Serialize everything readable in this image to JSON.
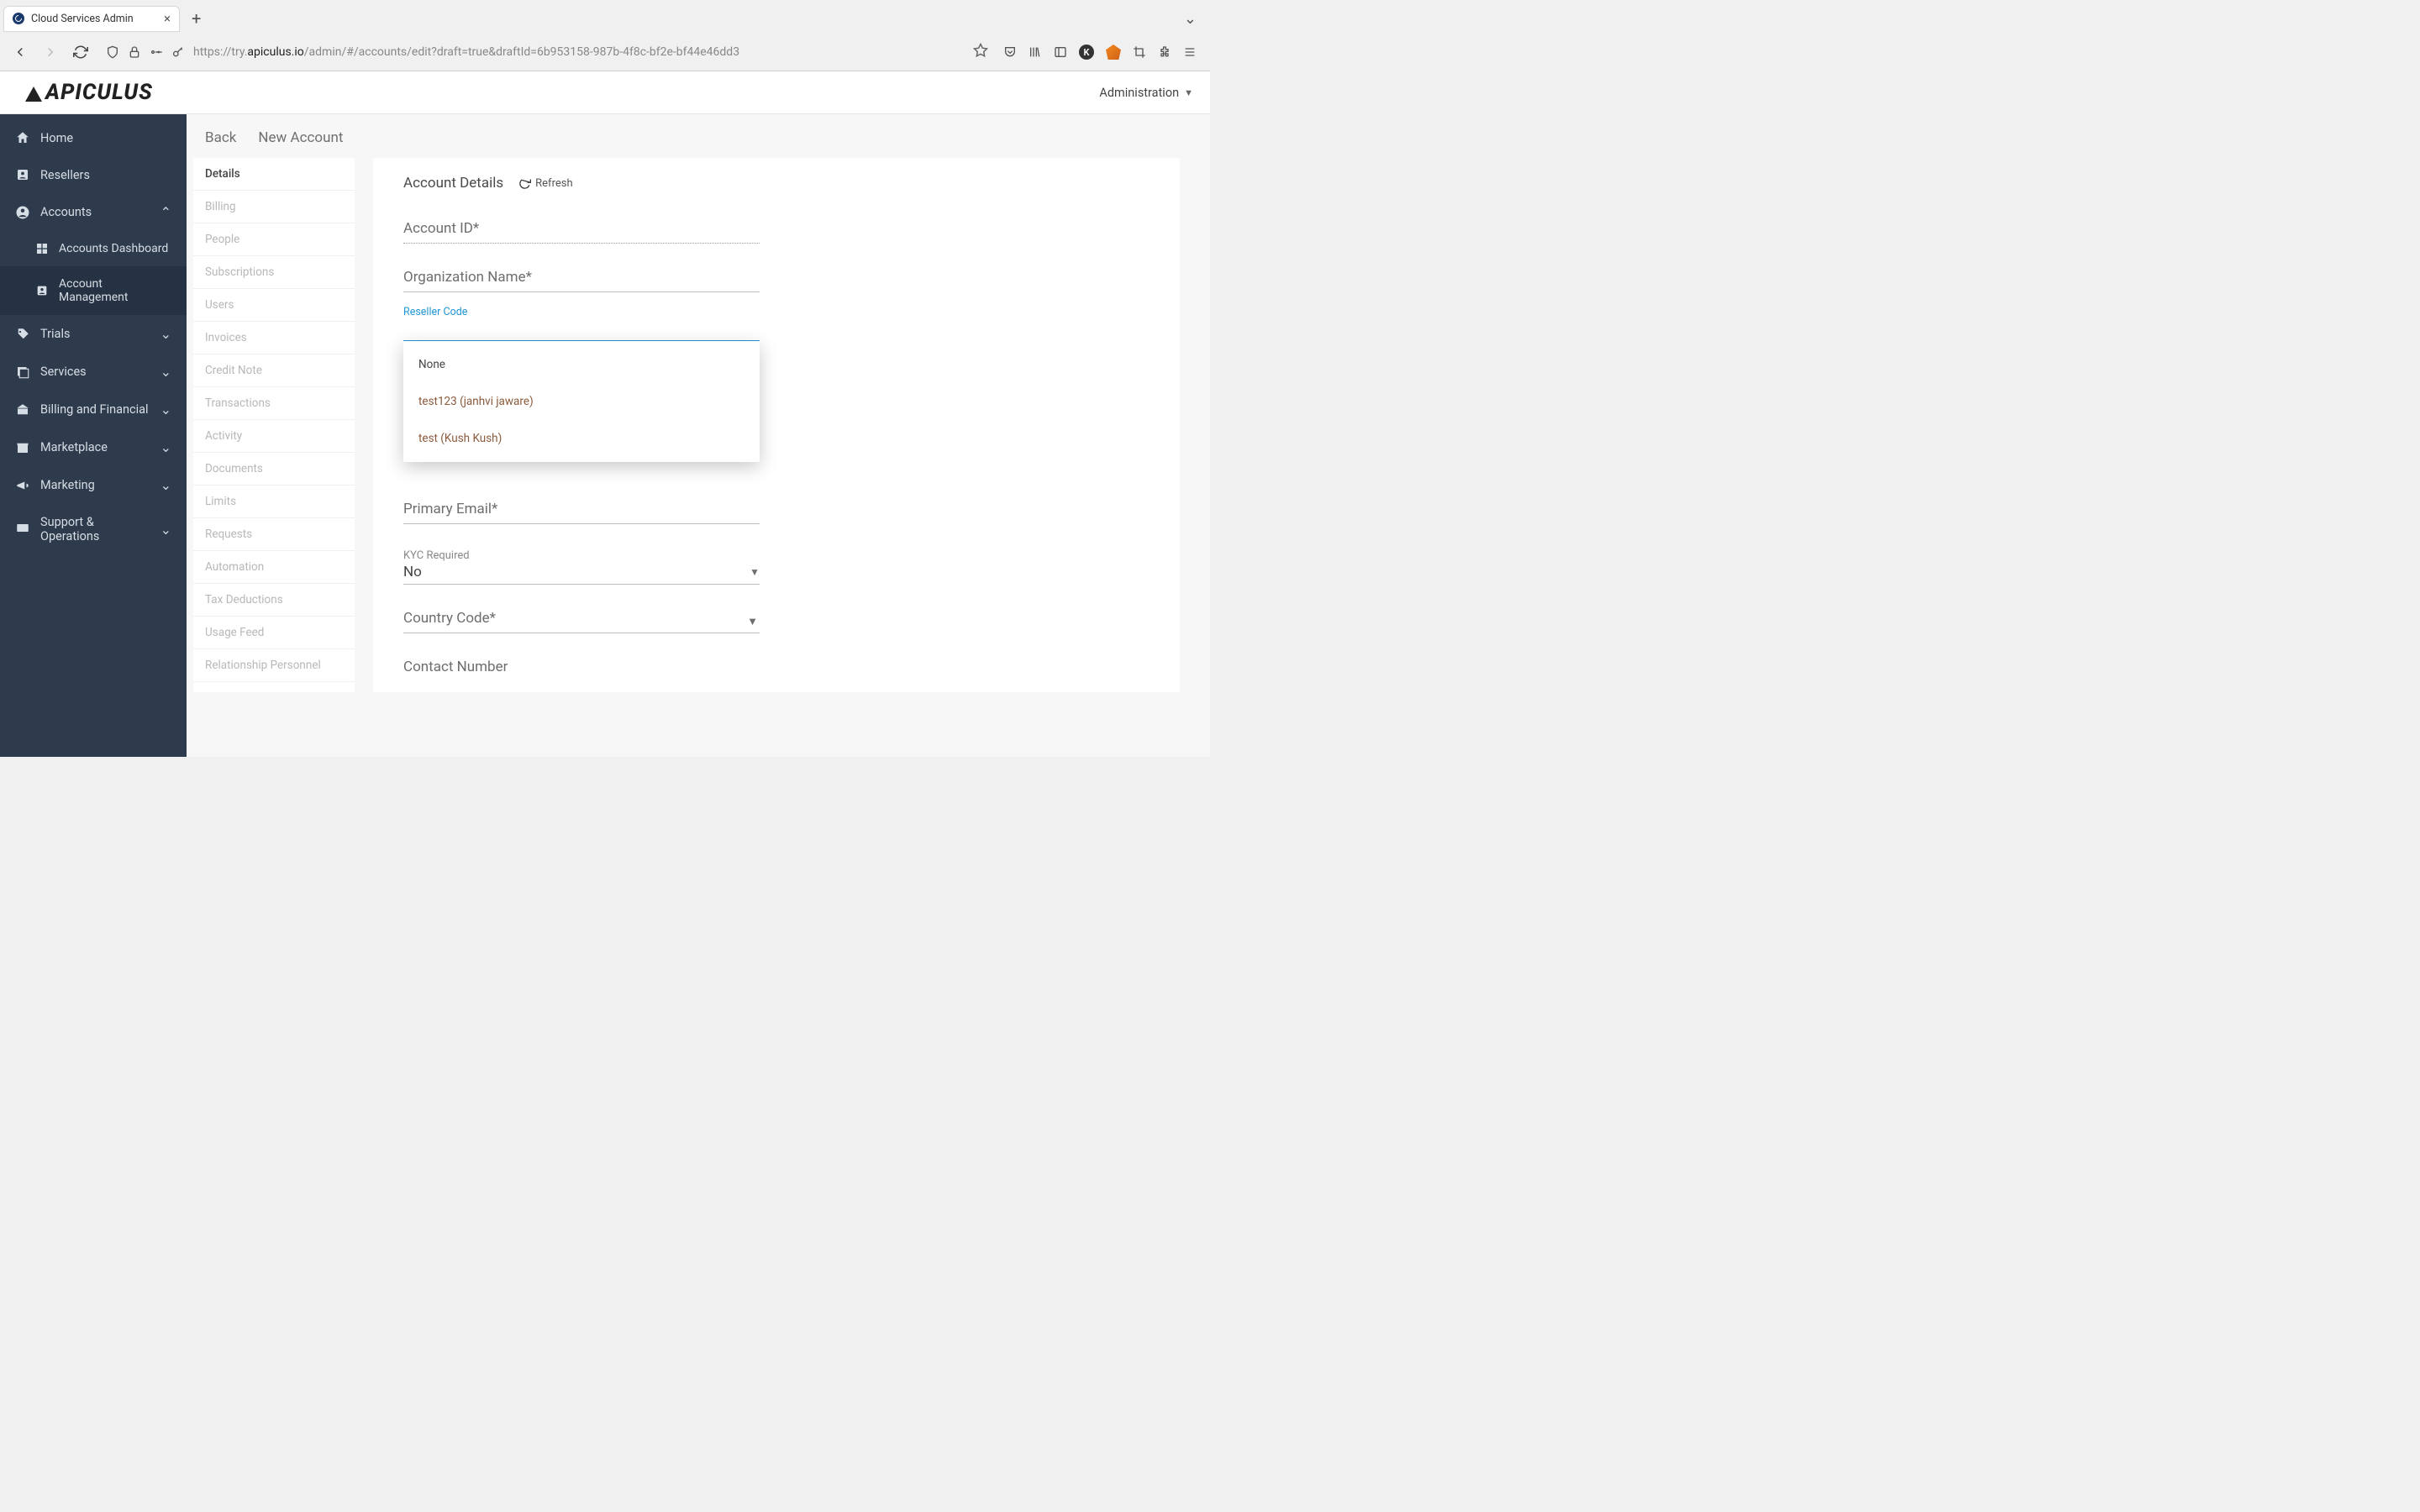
{
  "browser": {
    "tab_title": "Cloud Services Admin",
    "url_prefix": "https://try.",
    "url_host": "apiculus.io",
    "url_path": "/admin/#/accounts/edit?draft=true&draftId=6b953158-987b-4f8c-bf2e-bf44e46dd3"
  },
  "header": {
    "logo": "APICULUS",
    "admin_label": "Administration"
  },
  "sidebar": {
    "items": [
      {
        "label": "Home",
        "icon": "home"
      },
      {
        "label": "Resellers",
        "icon": "badge"
      },
      {
        "label": "Accounts",
        "icon": "person",
        "expanded": true
      },
      {
        "label": "Accounts Dashboard",
        "icon": "dashboard",
        "sub": true
      },
      {
        "label": "Account Management",
        "icon": "badge",
        "sub": true,
        "active": true
      },
      {
        "label": "Trials",
        "icon": "tag",
        "chev": true
      },
      {
        "label": "Services",
        "icon": "layers",
        "chev": true
      },
      {
        "label": "Billing and Financial",
        "icon": "bank",
        "chev": true
      },
      {
        "label": "Marketplace",
        "icon": "store",
        "chev": true
      },
      {
        "label": "Marketing",
        "icon": "megaphone",
        "chev": true
      },
      {
        "label": "Support & Operations",
        "icon": "monitor",
        "chev": true
      }
    ]
  },
  "content_header": {
    "back": "Back",
    "title": "New Account"
  },
  "subnav": {
    "items": [
      {
        "label": "Details",
        "active": true
      },
      {
        "label": "Billing"
      },
      {
        "label": "People"
      },
      {
        "label": "Subscriptions"
      },
      {
        "label": "Users"
      },
      {
        "label": "Invoices"
      },
      {
        "label": "Credit Note"
      },
      {
        "label": "Transactions"
      },
      {
        "label": "Activity"
      },
      {
        "label": "Documents"
      },
      {
        "label": "Limits"
      },
      {
        "label": "Requests"
      },
      {
        "label": "Automation"
      },
      {
        "label": "Tax Deductions"
      },
      {
        "label": "Usage Feed"
      },
      {
        "label": "Relationship Personnel"
      }
    ]
  },
  "panel": {
    "title": "Account Details",
    "refresh": "Refresh",
    "fields": {
      "account_id": "Account ID*",
      "org_name": "Organization Name*",
      "reseller_code": "Reseller Code",
      "primary_email": "Primary Email*",
      "kyc_label": "KYC Required",
      "kyc_value": "No",
      "country_code": "Country Code*",
      "contact_number": "Contact Number"
    },
    "reseller_options": [
      "None",
      "test123 (janhvi jaware)",
      "test (Kush Kush)"
    ]
  }
}
